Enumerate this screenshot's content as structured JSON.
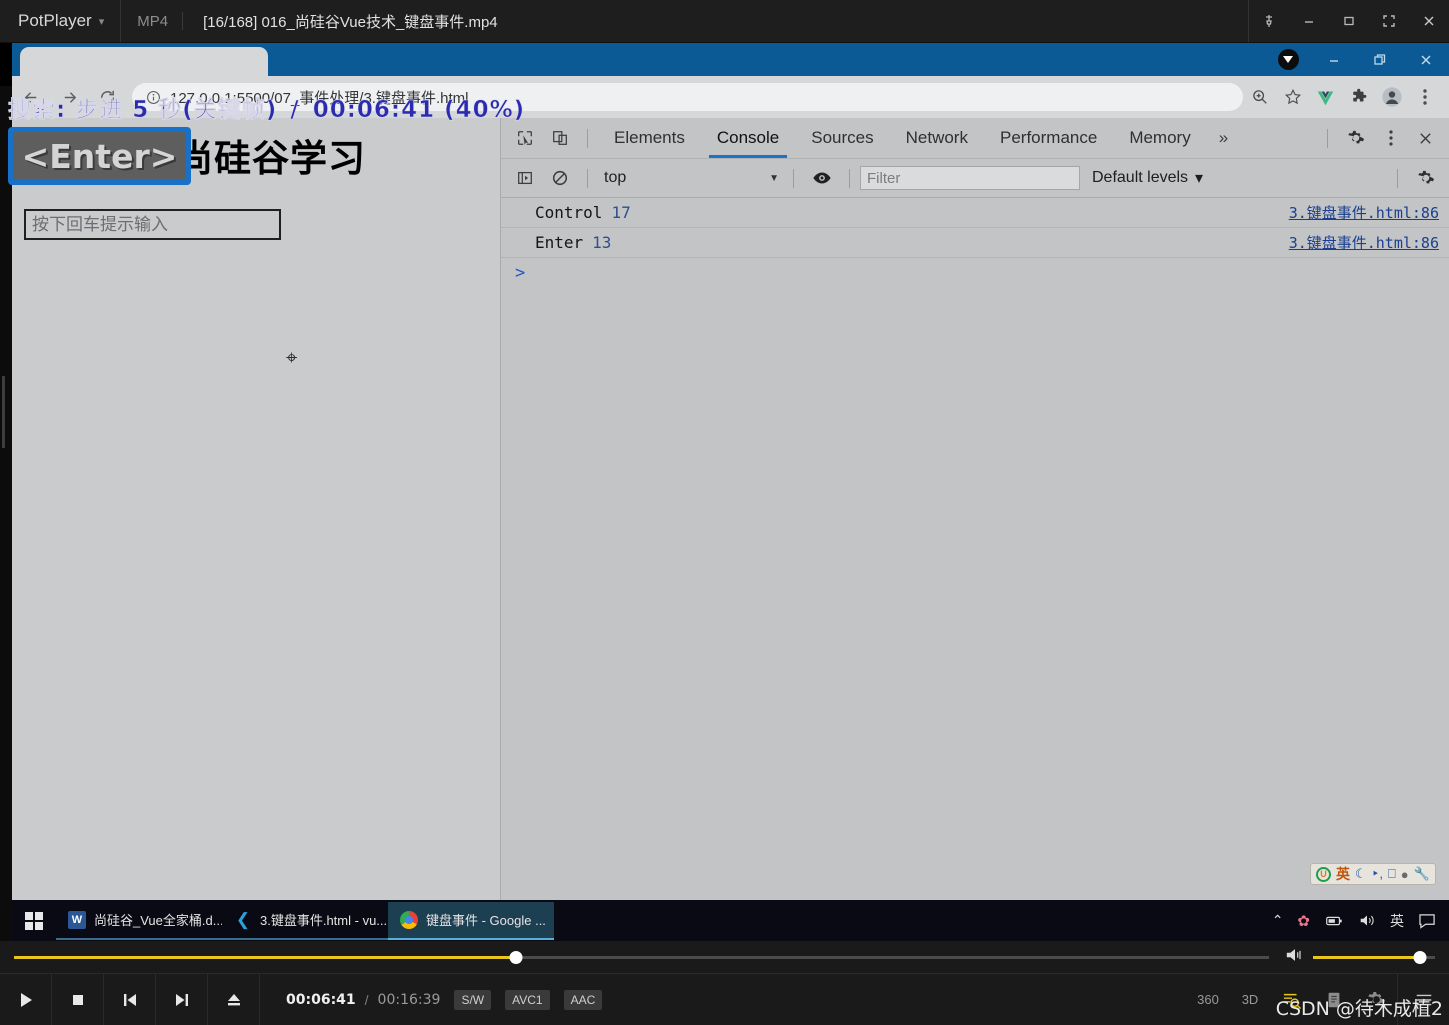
{
  "player": {
    "app_name": "PotPlayer",
    "format": "MP4",
    "file_title": "[16/168] 016_尚硅谷Vue技术_键盘事件.mp4",
    "window_buttons": [
      "pin",
      "minimize",
      "maximize",
      "fullscreen",
      "close"
    ],
    "osd": {
      "message": "搜索: 步进 5 秒(关键帧)",
      "separator": "/",
      "time_percent": "00:06:41 (40%)",
      "key_hint": "<Enter>"
    },
    "seek": {
      "progress_percent": 40
    },
    "volume": {
      "level_percent": 88
    },
    "time": {
      "current": "00:06:41",
      "separator": "/",
      "total": "00:16:39"
    },
    "badges": [
      "S/W",
      "AVC1",
      "AAC"
    ],
    "controls": [
      "play",
      "stop",
      "previous",
      "next",
      "eject"
    ],
    "right_controls": [
      "360",
      "3D",
      "subtitle-search",
      "playlist",
      "settings",
      "menu"
    ],
    "watermark": "CSDN @待木成植2"
  },
  "browser": {
    "window_buttons": [
      "download",
      "minimize",
      "restore",
      "close"
    ],
    "nav_buttons": [
      "back",
      "forward",
      "reload"
    ],
    "omnibox": {
      "security_icon": "info-circle",
      "url": "127.0.0.1:5500/07_事件处理/3.键盘事件.html"
    },
    "toolbar_icons": [
      "zoom",
      "bookmark-star",
      "vue-devtools",
      "extensions",
      "profile",
      "chrome-menu"
    ]
  },
  "page": {
    "heading": "欢迎来到尚硅谷学习",
    "input_placeholder": "按下回车提示输入",
    "input_value": ""
  },
  "devtools": {
    "left_icons": [
      "inspect-element",
      "device-toolbar"
    ],
    "tabs": [
      {
        "label": "Elements",
        "active": false
      },
      {
        "label": "Console",
        "active": true
      },
      {
        "label": "Sources",
        "active": false
      },
      {
        "label": "Network",
        "active": false
      },
      {
        "label": "Performance",
        "active": false
      },
      {
        "label": "Memory",
        "active": false
      }
    ],
    "more_tabs": "»",
    "right_icons": [
      "settings-gear",
      "devtools-menu",
      "close"
    ],
    "filterbar": {
      "sidebar_toggle": "console-sidebar",
      "clear_console": "clear",
      "context": "top",
      "eye_icon": "live-expression",
      "filter_placeholder": "Filter",
      "filter_value": "",
      "levels": "Default levels",
      "levels_caret": "▾",
      "settings_icon": "console-settings"
    },
    "console_logs": [
      {
        "text": "Control",
        "value": "17",
        "source": "3.键盘事件.html:86"
      },
      {
        "text": "Enter",
        "value": "13",
        "source": "3.键盘事件.html:86"
      }
    ],
    "prompt_caret": ">"
  },
  "ime_float": {
    "logo": "sogou-logo",
    "mode": "英",
    "items": [
      "moon",
      "comma",
      "keyboard",
      "user",
      "wrench"
    ]
  },
  "taskbar": {
    "start": "windows-start",
    "items": [
      {
        "label": "尚硅谷_Vue全家桶.d...",
        "icon": "word",
        "active": false
      },
      {
        "label": "3.键盘事件.html - vu...",
        "icon": "vscode",
        "active": false
      },
      {
        "label": "键盘事件 - Google ...",
        "icon": "chrome",
        "active": true
      }
    ],
    "tray": {
      "chevron": "⌃",
      "icons": [
        "sakura-ime",
        "battery",
        "volume"
      ],
      "ime_mode": "英",
      "notification": "action-center"
    }
  },
  "colors": {
    "accent_blue": "#1a73c8",
    "chrome_title": "#0b5a96",
    "seek_yellow": "#e8c61c",
    "osd_blue": "#2b2bb0"
  }
}
